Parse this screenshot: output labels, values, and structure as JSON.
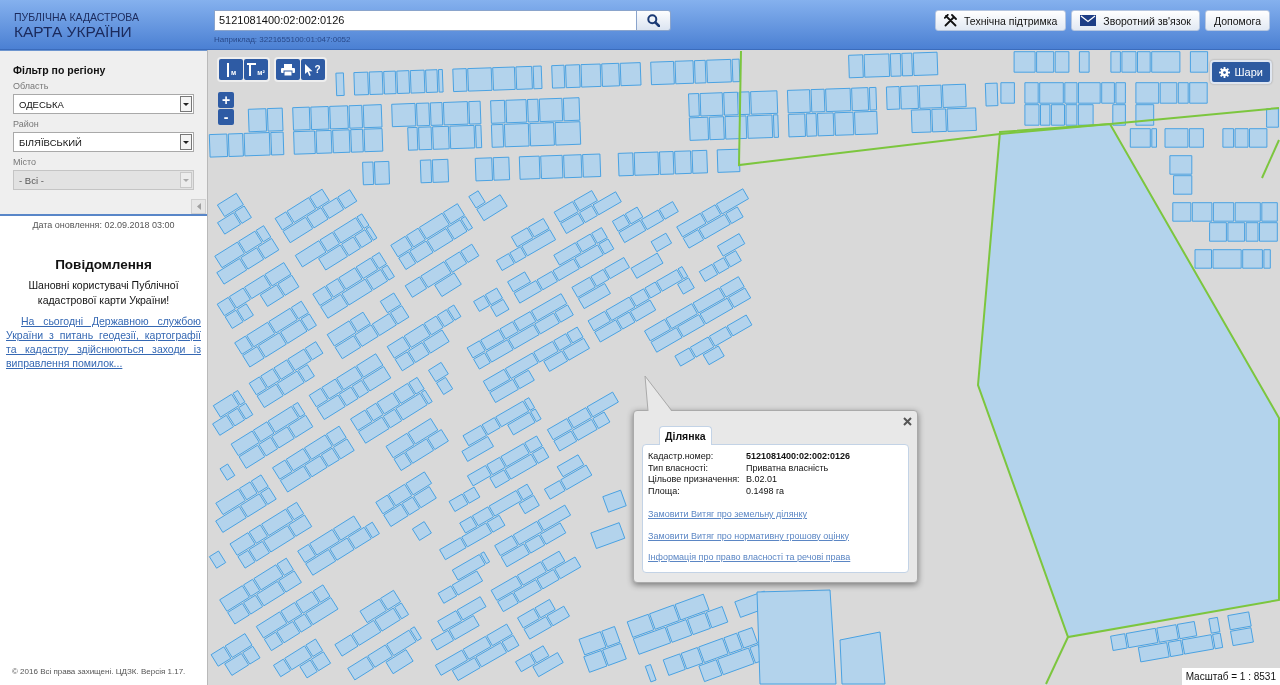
{
  "header": {
    "title": [
      "ПУБЛІЧНА КАДАСТРОВА",
      "КАРТА УКРАЇНИ"
    ],
    "search": {
      "value": "5121081400:02:002:0126",
      "hint": "Наприклад: 3221655100:01:047:0052"
    },
    "buttons": [
      {
        "kind": "support",
        "label": "Технічна підтримка"
      },
      {
        "kind": "feedback",
        "label": "Зворотний зв'язок"
      },
      {
        "kind": "help",
        "label": "Допомога"
      }
    ]
  },
  "sidebar": {
    "filter": {
      "title": "Фільтр по регіону",
      "fields": [
        {
          "label": "Область",
          "value": "ОДЕСЬКА",
          "disabled": false
        },
        {
          "label": "Район",
          "value": "БІЛЯЇВСЬКИЙ",
          "disabled": false
        },
        {
          "label": "Місто",
          "value": "- Всі -",
          "disabled": true
        }
      ]
    },
    "update_date": "Дата оновлення: 02.09.2018 03:00",
    "notice": {
      "title": "Повідомлення",
      "greeting": "Шановні користувачі Публічної кадастрової карти України!",
      "link": "На сьогодні Державною службою України з питань геодезії, картографії та кадастру здійснюються заходи із виправлення помилок..."
    },
    "footer": "© 2016 Всі права захищені. ЦДЗК. Версія 1.17."
  },
  "map": {
    "tool_groups": [
      [
        {
          "kind": "distance",
          "label": "м"
        },
        {
          "kind": "area",
          "label": "м²"
        }
      ],
      [
        {
          "kind": "print"
        },
        {
          "kind": "identify",
          "label": "?"
        }
      ]
    ],
    "zoom": [
      "+",
      "-"
    ],
    "layers_button": "Шари",
    "scale": "Масштаб = 1 : 8531",
    "popup": {
      "tabs": [
        {
          "label": "Ділянка",
          "selected": true
        }
      ],
      "rows": [
        {
          "label": "Кадастр.номер:",
          "value": "5121081400:02:002:0126"
        },
        {
          "label": "Тип власності:",
          "value": "Приватна власність"
        },
        {
          "label": "Цільове призначення:",
          "value": "В.02.01"
        },
        {
          "label": "Площа:",
          "value": "0.1498 га"
        }
      ],
      "links": [
        "Замовити Витяг про земельну ділянку",
        "Замовити Витяг про нормативну грошову оцінку",
        "Інформація про право власності та речові права"
      ]
    }
  }
}
